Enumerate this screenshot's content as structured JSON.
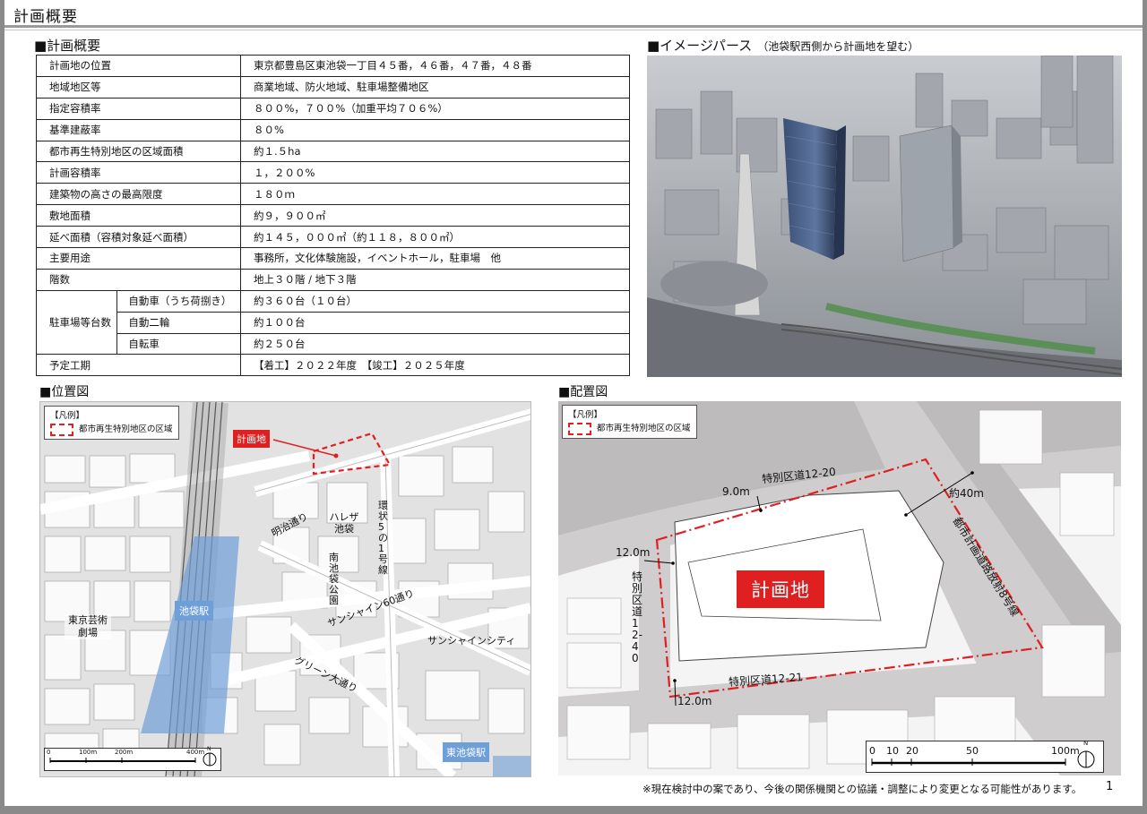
{
  "header": {
    "title": "計画概要"
  },
  "summary": {
    "heading": "■計画概要",
    "rows": [
      {
        "label": "計画地の位置",
        "value": "東京都豊島区東池袋一丁目４５番，４６番，４７番，４８番"
      },
      {
        "label": "地域地区等",
        "value": "商業地域、防火地域、駐車場整備地区"
      },
      {
        "label": "指定容積率",
        "value": "８００%，７００%（加重平均７０６%）"
      },
      {
        "label": "基準建蔽率",
        "value": "８０%"
      },
      {
        "label": "都市再生特別地区の区域面積",
        "value": "約１.５ha"
      },
      {
        "label": "計画容積率",
        "value": "１，２００%"
      },
      {
        "label": "建築物の高さの最高限度",
        "value": "１８０ｍ"
      },
      {
        "label": "敷地面積",
        "value": "約９，９００㎡"
      },
      {
        "label": "延べ面積（容積対象延べ面積）",
        "value": "約１４５，０００㎡（約１１８，８００㎡）"
      },
      {
        "label": "主要用途",
        "value": "事務所，文化体験施設，イベントホール，駐車場　他"
      },
      {
        "label": "階数",
        "value": "地上３０階 / 地下３階"
      }
    ],
    "parking": {
      "label": "駐車場等台数",
      "rows": [
        {
          "label": "自動車（うち荷捌き）",
          "value": "約３６０台（１０台）"
        },
        {
          "label": "自動二輪",
          "value": "約１００台"
        },
        {
          "label": "自転車",
          "value": "約２５０台"
        }
      ]
    },
    "schedule": {
      "label": "予定工期",
      "value": "【着工】２０２２年度　【竣工】２０２５年度"
    }
  },
  "perspective": {
    "heading": "■イメージパース",
    "caption": "（池袋駅西側から計画地を望む）"
  },
  "location_map": {
    "heading": "■位置図",
    "legend_title": "【凡例】",
    "legend_item": "都市再生特別地区の区域",
    "site_label": "計画地",
    "labels": {
      "station": "池袋駅",
      "east_station": "東池袋駅",
      "theatre": "東京芸術劇場",
      "sunshine_city": "サンシャインシティ",
      "meiji": "明治通り",
      "hareza": "ハレザ池袋",
      "minami_ikebukuro": "南池袋公園",
      "kanjo5": "環状5の1号線",
      "sunshine60": "サンシャイン60通り",
      "green": "グリーン大通り"
    },
    "scale": [
      "0",
      "100m",
      "200m",
      "400m"
    ],
    "north": "N"
  },
  "site_plan": {
    "heading": "■配置図",
    "legend_title": "【凡例】",
    "legend_item": "都市再生特別地区の区域",
    "site_label": "計画地",
    "roads": {
      "road_12_20": "特別区道12-20",
      "road_12_40": "特別区道12-40",
      "road_12_21": "特別区道12-21",
      "radial8": "都市計画道路放射8号線"
    },
    "widths": {
      "w9": "9.0m",
      "w12a": "12.0m",
      "w12b": "12.0m",
      "w40": "約40m"
    },
    "scale": [
      "0",
      "10",
      "20",
      "50",
      "100m"
    ],
    "north": "N"
  },
  "footer": {
    "note": "※現在検討中の案であり、今後の関係機関との協議・調整により変更となる可能性があります。",
    "page": "1"
  },
  "colors": {
    "accent_red": "#e02020",
    "station_blue": "#6f9fd8",
    "label_red_bg": "#e02020"
  }
}
